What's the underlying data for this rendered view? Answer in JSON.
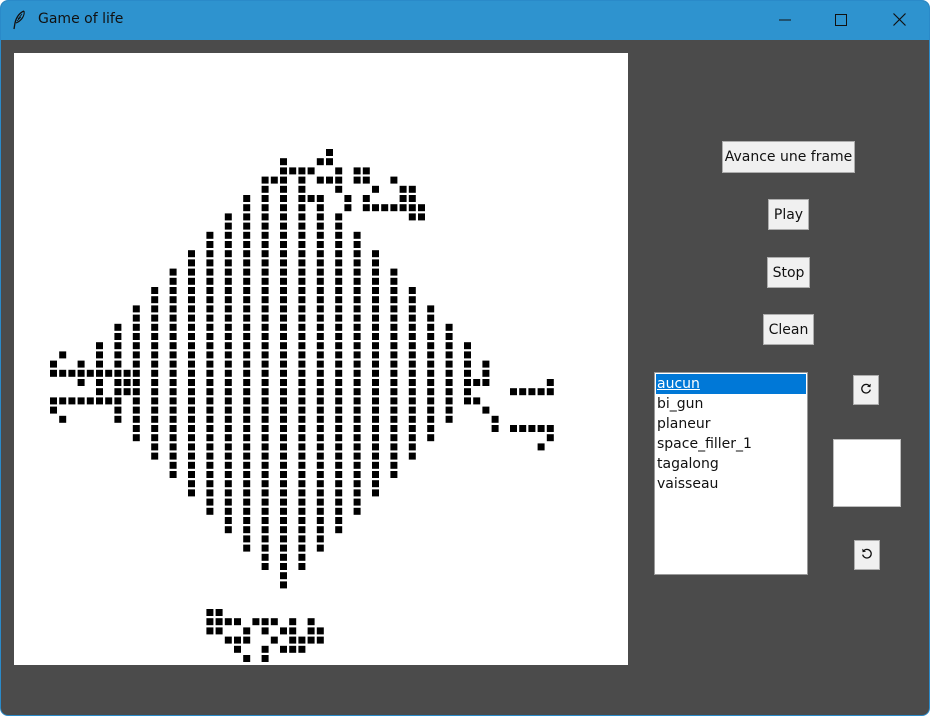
{
  "window": {
    "title": "Game of life",
    "icon": "feather-icon",
    "controls": {
      "minimize_icon": "minimize-icon",
      "maximize_icon": "maximize-icon",
      "close_icon": "close-icon"
    }
  },
  "colors": {
    "titlebar": "#2e93cf",
    "background": "#4b4b4b",
    "canvas": "#ffffff",
    "cell": "#000000",
    "selection": "#0078d7"
  },
  "controls": {
    "frame_label": "Avance une frame",
    "play_label": "Play",
    "stop_label": "Stop",
    "clean_label": "Clean",
    "rotate_left_icon": "rotate-counterclockwise-icon",
    "rotate_right_icon": "rotate-clockwise-icon"
  },
  "patterns": {
    "items": [
      "aucun",
      "bi_gun",
      "planeur",
      "space_filler_1",
      "tagalong",
      "vaisseau"
    ],
    "selected": "aucun"
  }
}
